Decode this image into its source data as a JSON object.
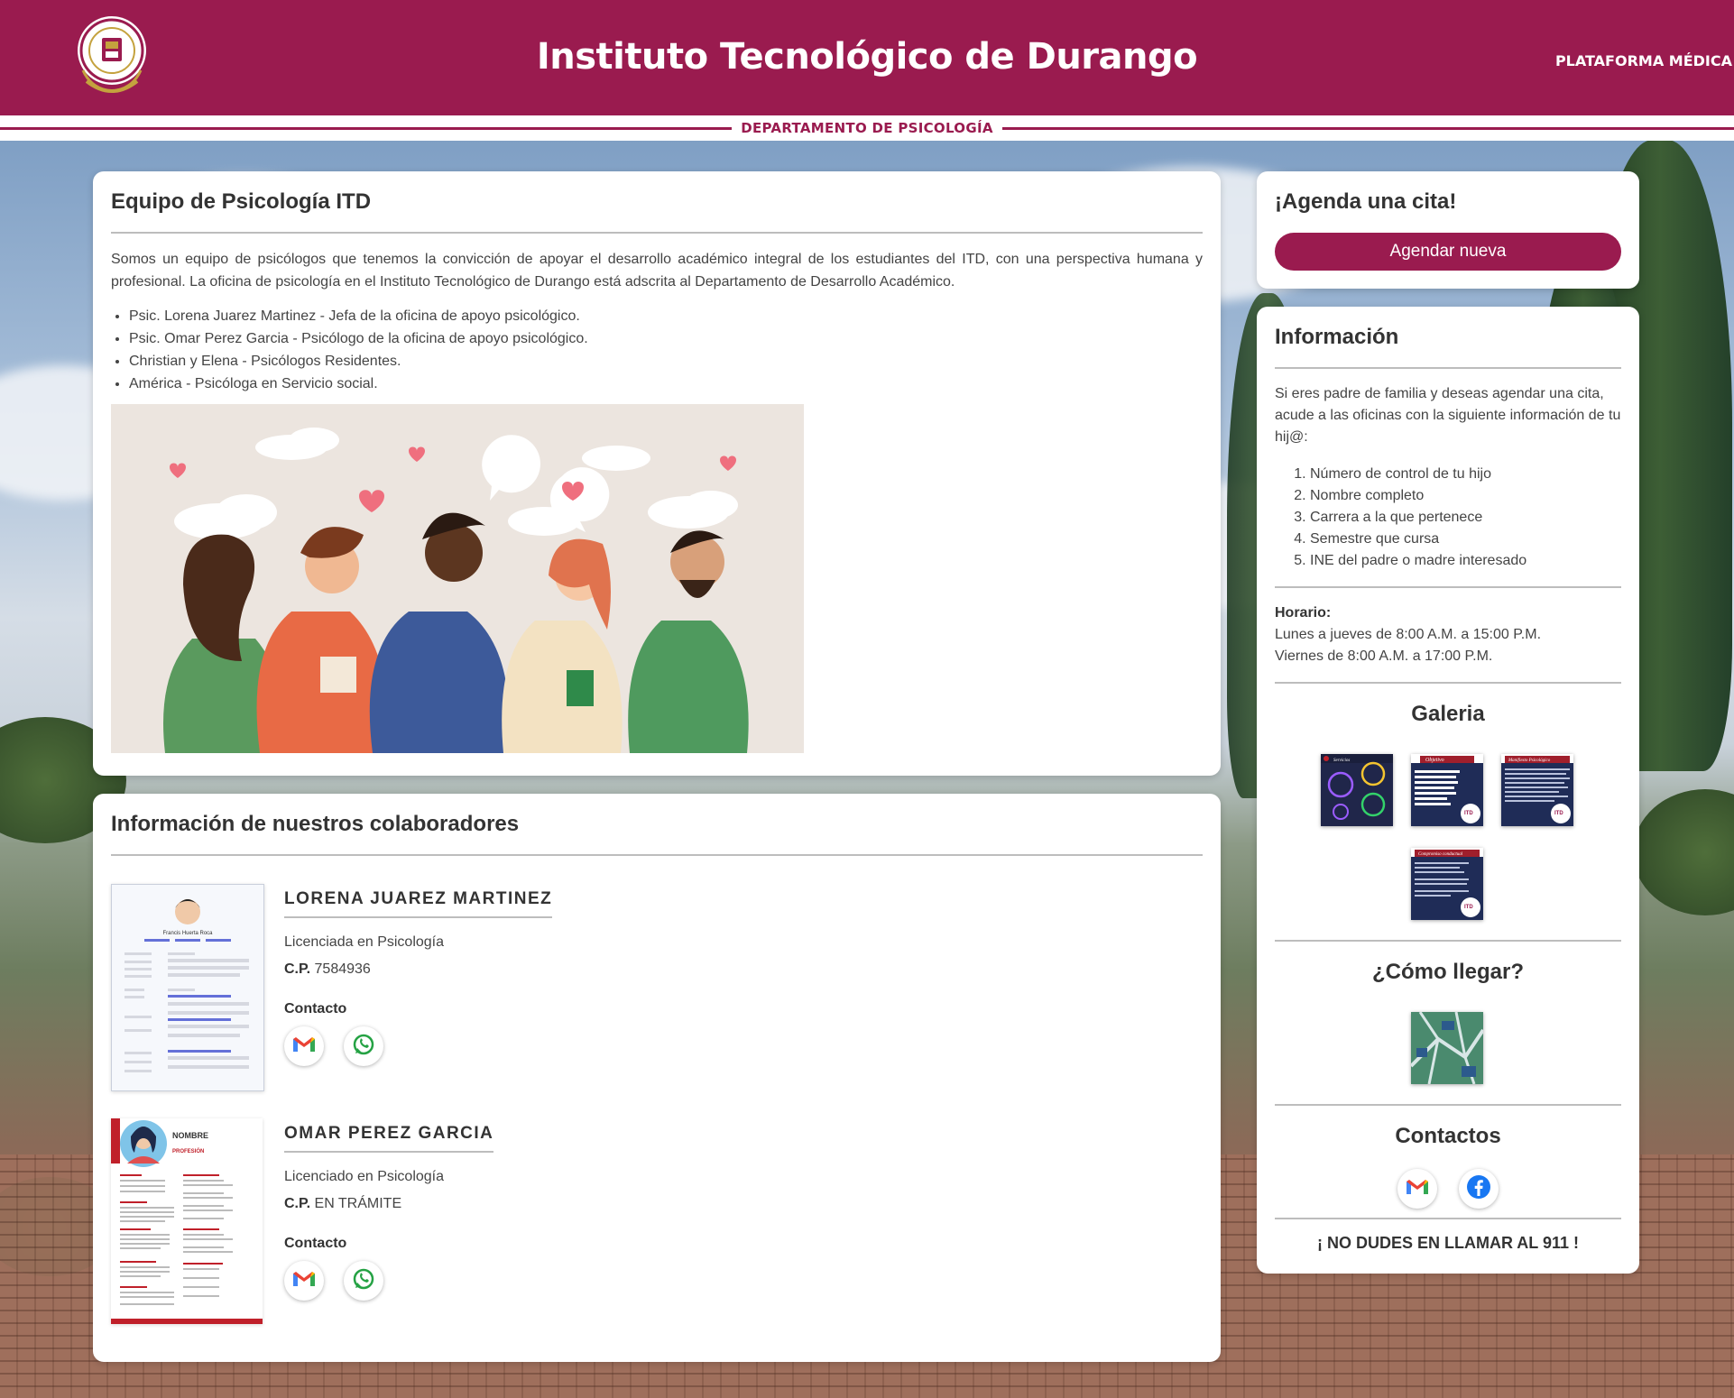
{
  "header": {
    "title": "Instituto Tecnológico de Durango",
    "platform_link": "PLATAFORMA MÉDICA",
    "department": "DEPARTAMENTO DE PSICOLOGÍA",
    "brand_color": "#9a1b4f"
  },
  "team": {
    "heading": "Equipo de Psicología ITD",
    "intro": "Somos un equipo de psicólogos que tenemos la convicción de apoyar el desarrollo académico integral de los estudiantes del ITD, con una perspectiva humana y profesional. La oficina de psicología en el Instituto Tecnológico de Durango está adscrita al Departamento de Desarrollo Académico.",
    "members": [
      "Psic. Lorena Juarez Martinez - Jefa de la oficina de apoyo psicológico.",
      "Psic. Omar Perez Garcia - Psicólogo de la oficina de apoyo psicológico.",
      "Christian y Elena - Psicólogos Residentes.",
      "América - Psicóloga en Servicio social."
    ]
  },
  "collaborators": {
    "heading": "Información de nuestros colaboradores",
    "people": [
      {
        "name": "LORENA JUAREZ MARTINEZ",
        "degree": "Licenciada en Psicología",
        "cp_label": "C.P.",
        "cp_value": "7584936",
        "contact_label": "Contacto",
        "cv_name": "Francis Huerta Roca",
        "contact_icons": [
          "gmail-icon",
          "whatsapp-icon"
        ]
      },
      {
        "name": "OMAR PEREZ GARCIA",
        "degree": "Licenciado en Psicología",
        "cp_label": "C.P.",
        "cp_value": "EN TRÁMITE",
        "contact_label": "Contacto",
        "cv_name": "NOMBRE",
        "cv_role": "PROFESIÓN",
        "contact_icons": [
          "gmail-icon",
          "whatsapp-icon"
        ]
      }
    ]
  },
  "agenda": {
    "heading": "¡Agenda una cita!",
    "button": "Agendar nueva"
  },
  "info": {
    "heading": "Información",
    "paragraph": "Si eres padre de familia y deseas agendar una cita, acude a las oficinas con la siguiente información de tu hij@:",
    "requirements": [
      "Número de control de tu hijo",
      "Nombre completo",
      "Carrera a la que pertenece",
      "Semestre que cursa",
      "INE del padre o madre interesado"
    ],
    "schedule_label": "Horario:",
    "schedule": [
      "Lunes a jueves de 8:00 A.M. a 15:00 P.M.",
      "Viernes de 8:00 A.M. a 17:00 P.M."
    ],
    "gallery_heading": "Galeria",
    "gallery": [
      {
        "caption": "Servicios"
      },
      {
        "caption": "Objetivo",
        "text": "Atender los fenómenos psicológicos que favorecen los medios para el aprendizaje, creando estrategias de prevención, atención y seguimiento."
      },
      {
        "caption": "Manifiesto Psicológico"
      },
      {
        "caption": "Compromiso conductual"
      }
    ],
    "directions_heading": "¿Cómo llegar?",
    "contacts_heading": "Contactos",
    "contact_icons": [
      "gmail-icon",
      "facebook-icon"
    ],
    "emergency": "¡ NO DUDES EN LLAMAR AL 911 !"
  }
}
